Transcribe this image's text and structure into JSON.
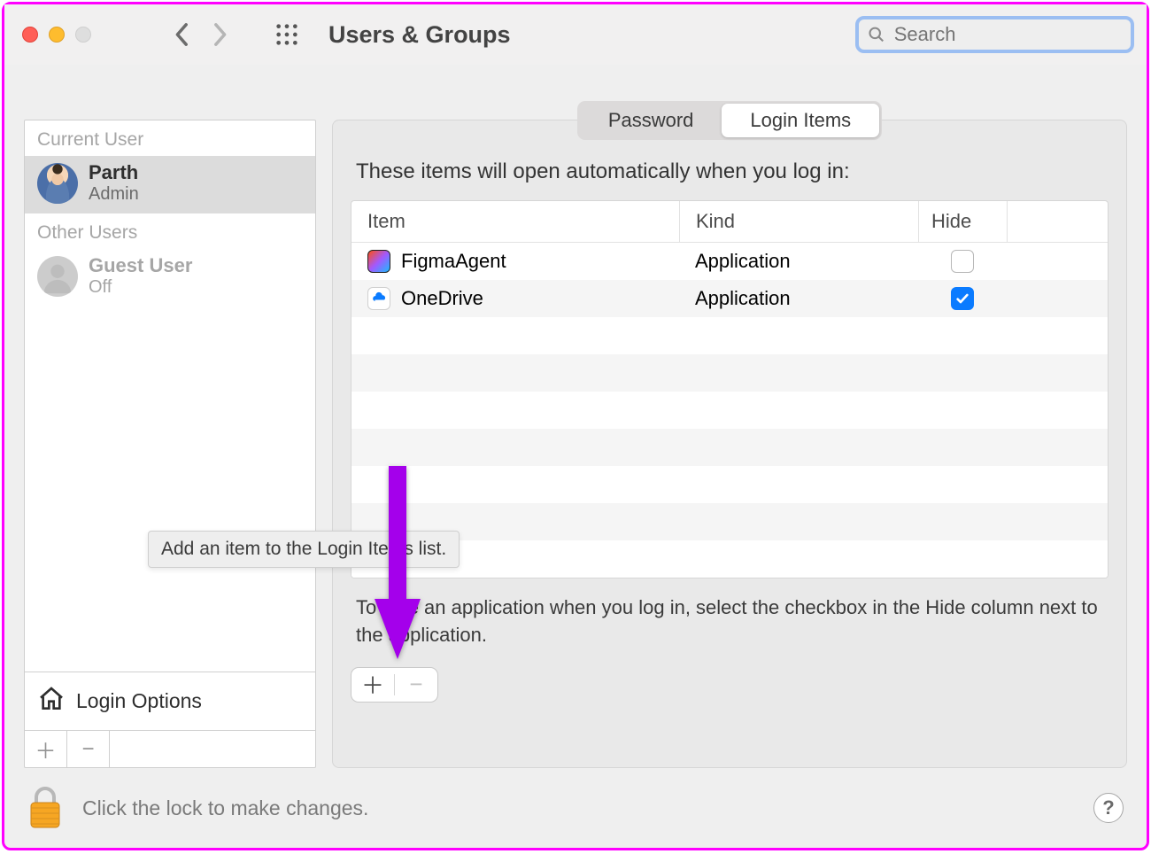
{
  "toolbar": {
    "title": "Users & Groups",
    "search_placeholder": "Search"
  },
  "sidebar": {
    "current_label": "Current User",
    "other_label": "Other Users",
    "current_user": {
      "name": "Parth",
      "role": "Admin"
    },
    "other_user": {
      "name": "Guest User",
      "role": "Off"
    },
    "login_options_label": "Login Options"
  },
  "tabs": {
    "password": "Password",
    "login_items": "Login Items"
  },
  "main": {
    "heading": "These items will open automatically when you log in:",
    "col_item": "Item",
    "col_kind": "Kind",
    "col_hide": "Hide",
    "rows": [
      {
        "name": "FigmaAgent",
        "kind": "Application",
        "hide": false,
        "icon": "figma"
      },
      {
        "name": "OneDrive",
        "kind": "Application",
        "hide": true,
        "icon": "onedrive"
      }
    ],
    "hint": "To hide an application when you log in, select the checkbox in the Hide column next to the application."
  },
  "tooltip": "Add an item to the Login Items list.",
  "footer": {
    "lock_text": "Click the lock to make changes.",
    "help": "?"
  },
  "colors": {
    "accent": "#0a7bff",
    "annotation": "#a400eb",
    "focus_ring": "#9bbef2"
  }
}
